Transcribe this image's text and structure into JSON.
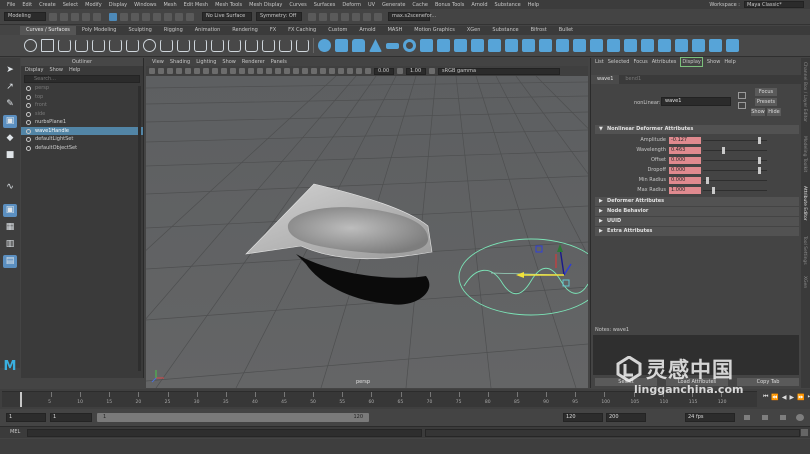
{
  "menubar": {
    "items": [
      "File",
      "Edit",
      "Create",
      "Select",
      "Modify",
      "Display",
      "Windows",
      "Mesh",
      "Edit Mesh",
      "Mesh Tools",
      "Mesh Display",
      "Curves",
      "Surfaces",
      "Deform",
      "UV",
      "Generate",
      "Cache",
      "Bonus Tools",
      "Arnold",
      "Substance",
      "Help"
    ],
    "workspace_label": "Workspace :",
    "workspace_value": "Maya Classic*"
  },
  "statusline": {
    "menuset": "Modeling",
    "live_surface": "No Live Surface",
    "symmetry": "Symmetry: Off",
    "scene_file": "max.s2scenefor..."
  },
  "shelf": {
    "tabs": [
      "Curves / Surfaces",
      "Poly Modeling",
      "Sculpting",
      "Rigging",
      "Animation",
      "Rendering",
      "FX",
      "FX Caching",
      "Custom",
      "Arnold",
      "MASH",
      "Motion Graphics",
      "XGen",
      "Substance",
      "Bifrost",
      "Bullet"
    ],
    "active_tab": 0
  },
  "outliner": {
    "title": "Outliner",
    "menus": [
      "Display",
      "Show",
      "Help"
    ],
    "search_placeholder": "Search...",
    "items": [
      {
        "label": "persp",
        "state": "dim"
      },
      {
        "label": "top",
        "state": "dim"
      },
      {
        "label": "front",
        "state": "dim"
      },
      {
        "label": "side",
        "state": "dim"
      },
      {
        "label": "nurbsPlane1",
        "state": "normal"
      },
      {
        "label": "wave1Handle",
        "state": "selected"
      },
      {
        "label": "defaultLightSet",
        "state": "normal"
      },
      {
        "label": "defaultObjectSet",
        "state": "normal"
      }
    ]
  },
  "viewport": {
    "menus": [
      "View",
      "Shading",
      "Lighting",
      "Show",
      "Renderer",
      "Panels"
    ],
    "field_a": "0.00",
    "field_b": "1.00",
    "colorspace": "sRGB gamma",
    "camera_label": "persp"
  },
  "attribute_editor": {
    "menus": [
      "List",
      "Selected",
      "Focus",
      "Attributes",
      "Display",
      "Show",
      "Help"
    ],
    "active_menu": "Display",
    "tabs": [
      "wave1",
      "bend1"
    ],
    "node_label": "nonLinear:",
    "node_value": "wave1",
    "focus_btn": "Focus",
    "presets_btn": "Presets",
    "show_btn": "Show",
    "hide_btn": "Hide",
    "section_open": "Nonlinear Deformer Attributes",
    "attrs": [
      {
        "label": "Amplitude",
        "value": "-0.127",
        "pos": 0.88
      },
      {
        "label": "Wavelength",
        "value": "0.463",
        "pos": 0.3
      },
      {
        "label": "Offset",
        "value": "0.000",
        "pos": 0.88
      },
      {
        "label": "Dropoff",
        "value": "0.000",
        "pos": 0.88
      },
      {
        "label": "Min Radius",
        "value": "0.000",
        "pos": 0.05
      },
      {
        "label": "Max Radius",
        "value": "1.000",
        "pos": 0.15
      }
    ],
    "sections_closed": [
      "Deformer Attributes",
      "Node Behavior",
      "UUID",
      "Extra Attributes"
    ],
    "notes_label": "Notes: wave1",
    "bottom_buttons": [
      "Select",
      "Load Attributes",
      "Copy Tab"
    ]
  },
  "sidetabs": [
    "Channel Box / Layer Editor",
    "Modeling Toolkit",
    "Attribute Editor",
    "Tool Settings",
    "XGen"
  ],
  "timeline": {
    "ticks": [
      "5",
      "10",
      "15",
      "20",
      "25",
      "30",
      "35",
      "40",
      "45",
      "50",
      "55",
      "60",
      "65",
      "70",
      "75",
      "80",
      "85",
      "90",
      "95",
      "100",
      "105",
      "110",
      "115",
      "120"
    ],
    "current": "1"
  },
  "range": {
    "start": "1",
    "playback_start": "1",
    "range_start": "1",
    "range_end": "120",
    "playback_end": "120",
    "end": "200",
    "fps": "24 fps"
  },
  "cmdline": {
    "label": "MEL"
  },
  "watermark": {
    "cn": "灵感中国",
    "url": "lingganchina.com"
  },
  "colors": {
    "selection": "#5285a6",
    "field_keyed": "#e08a8f",
    "accent": "#57a4d8"
  }
}
